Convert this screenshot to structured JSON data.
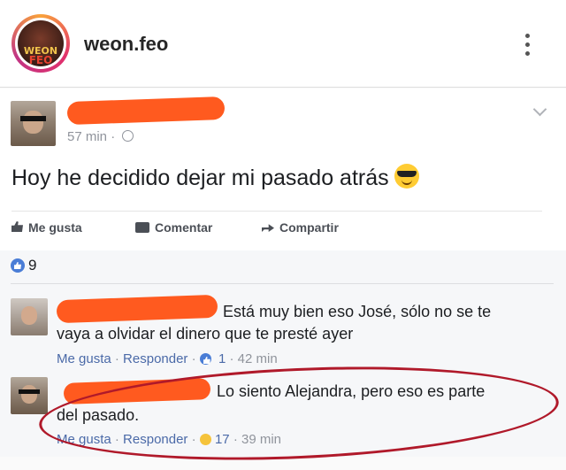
{
  "header": {
    "username": "weon.feo",
    "logo_text_top": "WEON",
    "logo_text_bottom": "FEO",
    "more_icon": "more-vertical-icon"
  },
  "post": {
    "timestamp": "57 min",
    "separator": "·",
    "privacy_icon": "globe-icon",
    "text": "Hoy he decidido dejar mi pasado atrás",
    "emoji": "sunglasses-emoji",
    "actions": {
      "like": "Me gusta",
      "comment": "Comentar",
      "share": "Compartir"
    },
    "like_count": "9"
  },
  "comments": [
    {
      "text_line1": "Está muy bien eso José, sólo no se te",
      "text_line2": "vaya a olvidar el dinero que te presté ayer",
      "like": "Me gusta",
      "reply": "Responder",
      "reaction_count": "1",
      "time": "42 min"
    },
    {
      "text_line1": "Lo siento Alejandra, pero eso es parte",
      "text_line2": "del pasado.",
      "like": "Me gusta",
      "reply": "Responder",
      "reaction_count": "17",
      "time": "39 min"
    }
  ],
  "colors": {
    "redaction": "#ff5a1f",
    "annotation_circle": "#b0192a",
    "facebook_blue": "#4b6aa8"
  }
}
